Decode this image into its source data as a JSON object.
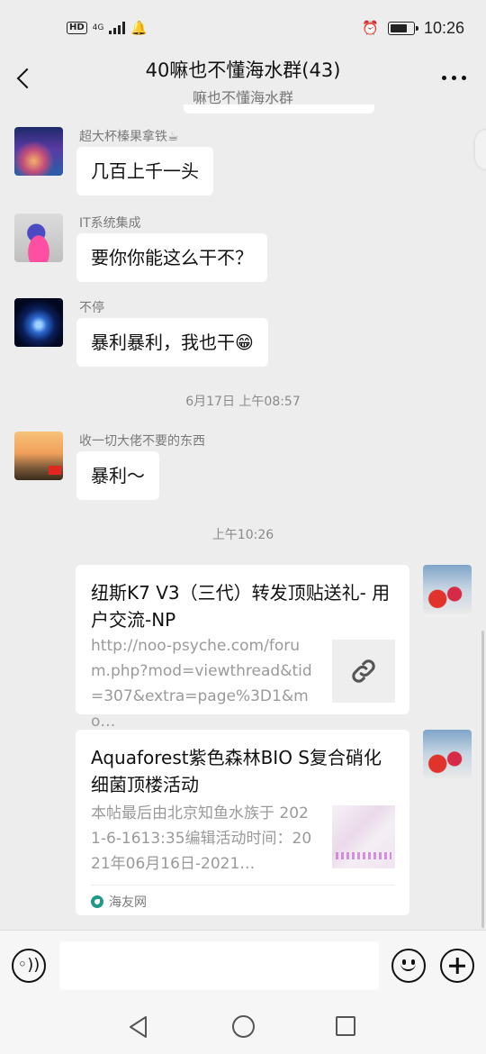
{
  "status_bar": {
    "hd": "HD",
    "network": "4G",
    "time": "10:26",
    "battery_level": 0.8
  },
  "header": {
    "title": "40嘛也不懂海水群(43)",
    "subtitle": "嘛也不懂海水群"
  },
  "messages": [
    {
      "sender": "超大杯榛果拿铁☕",
      "text": "几百上千一头"
    },
    {
      "sender": "IT系统集成",
      "text": "要你你能这么干不？"
    },
    {
      "sender": "不停",
      "text": "暴利暴利，我也干😁"
    },
    {
      "timestamp": "6月17日 上午08:57"
    },
    {
      "sender": "收一切大佬不要的东西",
      "text": "暴利～"
    },
    {
      "timestamp": "上午10:26"
    }
  ],
  "cards": [
    {
      "title": "纽斯K7 V3（三代）转发顶贴送礼- 用户交流-NP",
      "desc": "http://noo-psyche.com/forum.php?mod=viewthread&tid=307&extra=page%3D1&mo…",
      "thumb_icon": "link-icon"
    },
    {
      "title": "Aquaforest紫色森林BIO S复合硝化细菌顶楼活动",
      "desc": "本帖最后由北京知鱼水族于 2021-6-1613:35编辑活动时间：2021年06月16日-2021…",
      "source": "海友网"
    }
  ],
  "input": {
    "placeholder": ""
  },
  "colors": {
    "background": "#ededed",
    "bubble": "#ffffff",
    "meta_text": "#8a8a8a"
  }
}
